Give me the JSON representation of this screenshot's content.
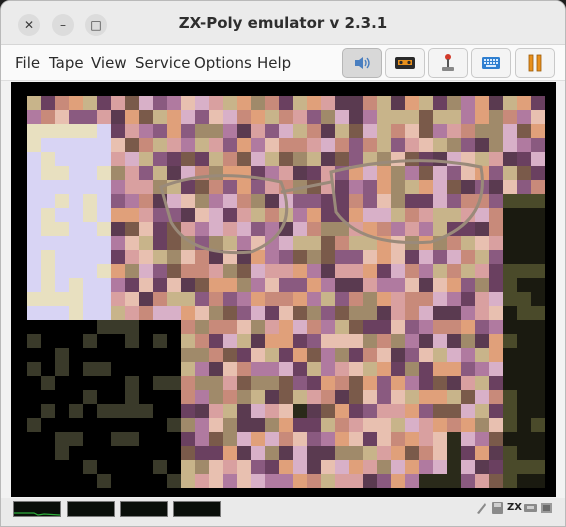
{
  "window": {
    "title": "ZX-Poly emulator v 2.3.1",
    "controls": {
      "close": "✕",
      "minimize": "–",
      "maximize": "□"
    }
  },
  "menu": {
    "items": [
      "File",
      "Tape",
      "View",
      "Service",
      "Options",
      "Help"
    ]
  },
  "toolbar": {
    "buttons": [
      {
        "icon": "speaker-icon",
        "pressed": true
      },
      {
        "icon": "tape-cassette-icon",
        "pressed": false
      },
      {
        "icon": "joystick-icon",
        "pressed": false
      },
      {
        "icon": "keyboard-icon",
        "pressed": false
      },
      {
        "icon": "pause-icon",
        "pressed": false
      }
    ]
  },
  "screen": {
    "content": "zx-poly-portrait-image"
  },
  "statusbar": {
    "indicators": [
      "cpu0-activity-indicator",
      "cpu1-activity-indicator",
      "cpu2-activity-indicator",
      "cpu3-activity-indicator"
    ],
    "zx_label": "ZX",
    "icons": [
      "turbo-icon",
      "disk-icon",
      "zx-mode-icon",
      "tape-status-icon",
      "lock-icon"
    ]
  },
  "colors": {
    "accent_orange": "#e8901c",
    "screen_bg": "#000000",
    "indicator_trace": "#2fae3c"
  }
}
